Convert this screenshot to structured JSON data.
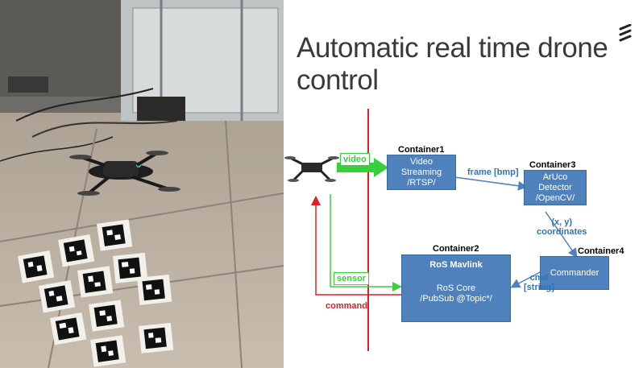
{
  "title": "Automatic real time drone control",
  "containers": {
    "c1": {
      "name": "Container1",
      "lines": [
        "Video",
        "Streaming",
        "/RTSP/"
      ]
    },
    "c2": {
      "name": "Container2",
      "heading": "RoS Mavlink",
      "lines": [
        "RoS Core",
        "/PubSub @Topic*/"
      ]
    },
    "c3": {
      "name": "Container3",
      "lines": [
        "ArUco",
        "Detector",
        "/OpenCV/"
      ]
    },
    "c4": {
      "name": "Container4",
      "lines": [
        "Commander"
      ]
    }
  },
  "labels": {
    "video": "video",
    "frame": "frame [bmp]",
    "xy_line1": "(x, y)",
    "xy_line2": "coordinates",
    "cmd_line1": "cmd",
    "cmd_line2": "[string]",
    "sensor": "sensor",
    "command": "command"
  },
  "colors": {
    "box": "#4f81bd",
    "blue_arrow": "#4f81bd",
    "green": "#38d038",
    "red": "#e02020",
    "label_blue": "#2f75b5"
  },
  "photo": {
    "icons": [
      "drone",
      "aruco-markers",
      "floor-tiles",
      "server-rack"
    ]
  }
}
